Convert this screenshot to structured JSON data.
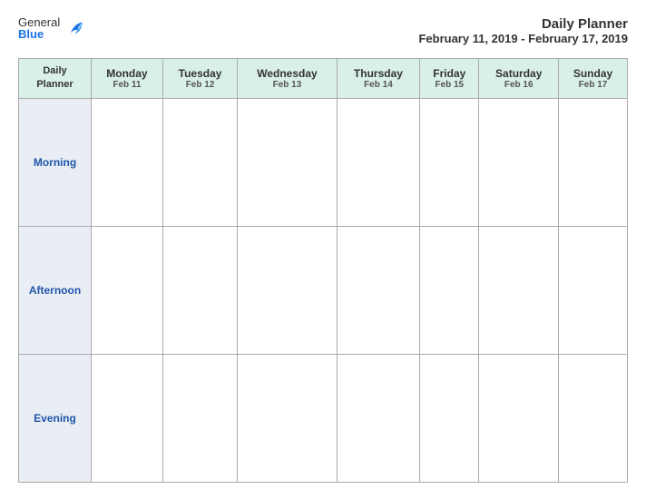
{
  "header": {
    "logo": {
      "general": "General",
      "blue": "Blue"
    },
    "title": "Daily Planner",
    "date_range": "February 11, 2019 - February 17, 2019"
  },
  "table": {
    "first_col_header": "Daily\nPlanner",
    "days": [
      {
        "name": "Monday",
        "date": "Feb 11"
      },
      {
        "name": "Tuesday",
        "date": "Feb 12"
      },
      {
        "name": "Wednesday",
        "date": "Feb 13"
      },
      {
        "name": "Thursday",
        "date": "Feb 14"
      },
      {
        "name": "Friday",
        "date": "Feb 15"
      },
      {
        "name": "Saturday",
        "date": "Feb 16"
      },
      {
        "name": "Sunday",
        "date": "Feb 17"
      }
    ],
    "rows": [
      {
        "label": "Morning"
      },
      {
        "label": "Afternoon"
      },
      {
        "label": "Evening"
      }
    ]
  }
}
